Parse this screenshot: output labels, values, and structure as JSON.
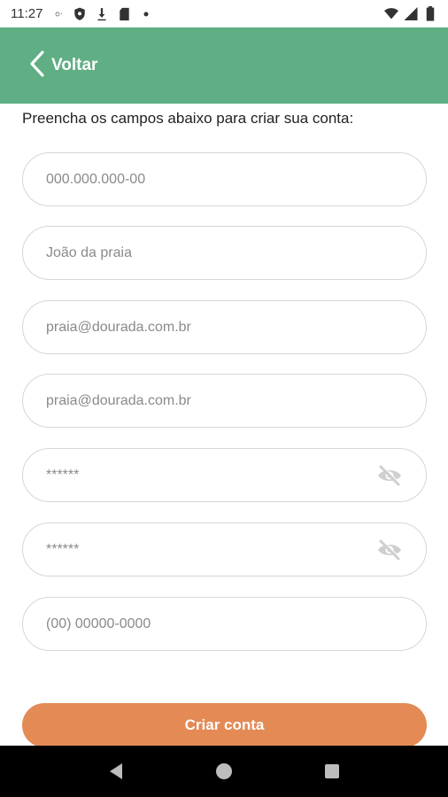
{
  "status_bar": {
    "time": "11:27",
    "icons_left": [
      "gear-icon",
      "shield-icon",
      "download-icon",
      "sd-card-icon",
      "dot-icon"
    ],
    "icons_right": [
      "wifi-icon",
      "signal-icon",
      "battery-icon"
    ]
  },
  "header": {
    "back_label": "Voltar",
    "background": "#5fae84"
  },
  "form": {
    "instructions": "Preencha os campos abaixo para criar sua conta:",
    "fields": [
      {
        "placeholder": "000.000.000-00",
        "type": "text"
      },
      {
        "placeholder": "João da praia",
        "type": "text"
      },
      {
        "placeholder": "praia@dourada.com.br",
        "type": "email"
      },
      {
        "placeholder": "praia@dourada.com.br",
        "type": "email"
      },
      {
        "placeholder": "******",
        "type": "password",
        "icon": "eye-off-icon"
      },
      {
        "placeholder": "******",
        "type": "password",
        "icon": "eye-off-icon"
      },
      {
        "placeholder": "(00) 00000-0000",
        "type": "tel"
      }
    ],
    "submit_label": "Criar conta",
    "submit_color": "#e38a55"
  },
  "nav": {
    "buttons": [
      "back-triangle-icon",
      "home-circle-icon",
      "recents-square-icon"
    ]
  }
}
